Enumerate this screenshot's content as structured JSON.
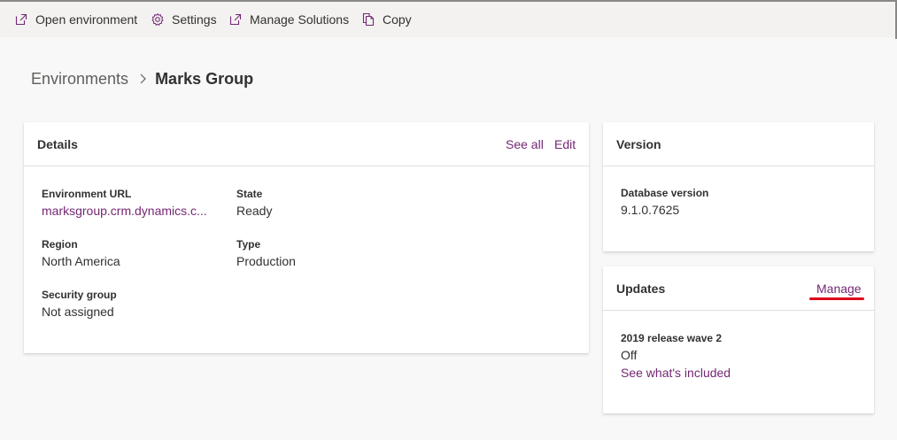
{
  "commandbar": {
    "items": [
      {
        "label": "Open environment",
        "icon": "open-external-icon"
      },
      {
        "label": "Settings",
        "icon": "gear-icon"
      },
      {
        "label": "Manage Solutions",
        "icon": "open-external-icon"
      },
      {
        "label": "Copy",
        "icon": "copy-icon"
      }
    ]
  },
  "breadcrumb": {
    "parent": "Environments",
    "current": "Marks Group"
  },
  "details": {
    "title": "Details",
    "see_all": "See all",
    "edit": "Edit",
    "fields": {
      "environment_url": {
        "label": "Environment URL",
        "value": "marksgroup.crm.dynamics.c..."
      },
      "state": {
        "label": "State",
        "value": "Ready"
      },
      "region": {
        "label": "Region",
        "value": "North America"
      },
      "type": {
        "label": "Type",
        "value": "Production"
      },
      "security_group": {
        "label": "Security group",
        "value": "Not assigned"
      }
    }
  },
  "version": {
    "title": "Version",
    "database_version": {
      "label": "Database version",
      "value": "9.1.0.7625"
    }
  },
  "updates": {
    "title": "Updates",
    "manage": "Manage",
    "release": {
      "label": "2019 release wave 2",
      "value": "Off",
      "link": "See what's included"
    }
  },
  "colors": {
    "link": "#742774",
    "text": "#323130",
    "annotation": "#e0001a",
    "commandbar_bg": "#f3f2f1",
    "page_bg": "#f8f8f8"
  }
}
